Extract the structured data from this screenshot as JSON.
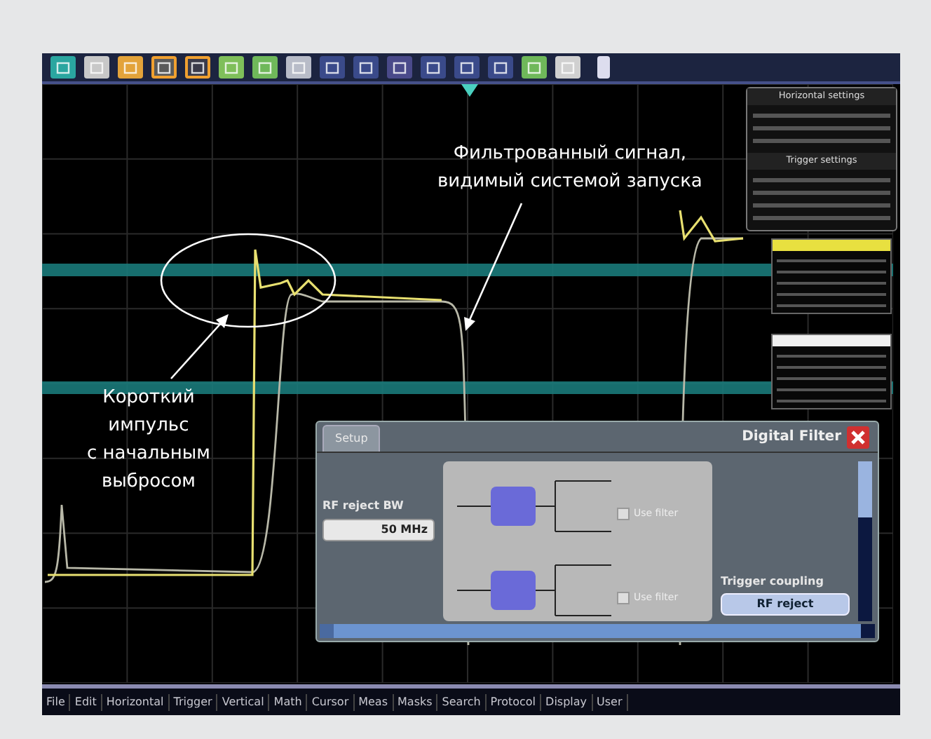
{
  "toolbar": [
    {
      "color": "#2aa6a0",
      "selected": false
    },
    {
      "color": "#c8c8c8",
      "selected": false
    },
    {
      "color": "#e3a33a",
      "selected": false
    },
    {
      "color": "#5a5a5a",
      "selected": true
    },
    {
      "color": "#3a3a4a",
      "selected": true
    },
    {
      "color": "#7fbf5a",
      "selected": false
    },
    {
      "color": "#6fb85a",
      "selected": false
    },
    {
      "color": "#b8bcc8",
      "selected": false
    },
    {
      "color": "#3a4a8a",
      "selected": false
    },
    {
      "color": "#3a4a8a",
      "selected": false
    },
    {
      "color": "#4a4a8a",
      "selected": false
    },
    {
      "color": "#3a4a8a",
      "selected": false
    },
    {
      "color": "#3a4a8a",
      "selected": false
    },
    {
      "color": "#3a4a8a",
      "selected": false
    },
    {
      "color": "#6fb85a",
      "selected": false
    },
    {
      "color": "#d0d0d0",
      "selected": false
    }
  ],
  "horizontal_panel": {
    "title": "Horizontal settings",
    "section": "Trigger settings"
  },
  "annotations": [
    {
      "text": "Фильтрованный сигнал,\nвидимый системой запуска"
    },
    {
      "text": "Короткий\nимпульс\nс начальным\nвыбросом"
    }
  ],
  "dialog": {
    "title": "Digital Filter",
    "tabs": [
      {
        "label": "Setup",
        "selected": true
      }
    ],
    "bw_label": "RF reject BW",
    "bw_value": "50 MHz",
    "filters": [
      {
        "use_label": "Use filter",
        "checked": false
      },
      {
        "use_label": "Use filter",
        "checked": false
      }
    ],
    "coupling_label": "Trigger coupling",
    "coupling_value": "RF reject"
  },
  "menu": [
    "File",
    "Edit",
    "Horizontal",
    "Trigger",
    "Vertical",
    "Math",
    "Cursor",
    "Meas",
    "Masks",
    "Search",
    "Protocol",
    "Display",
    "User"
  ]
}
